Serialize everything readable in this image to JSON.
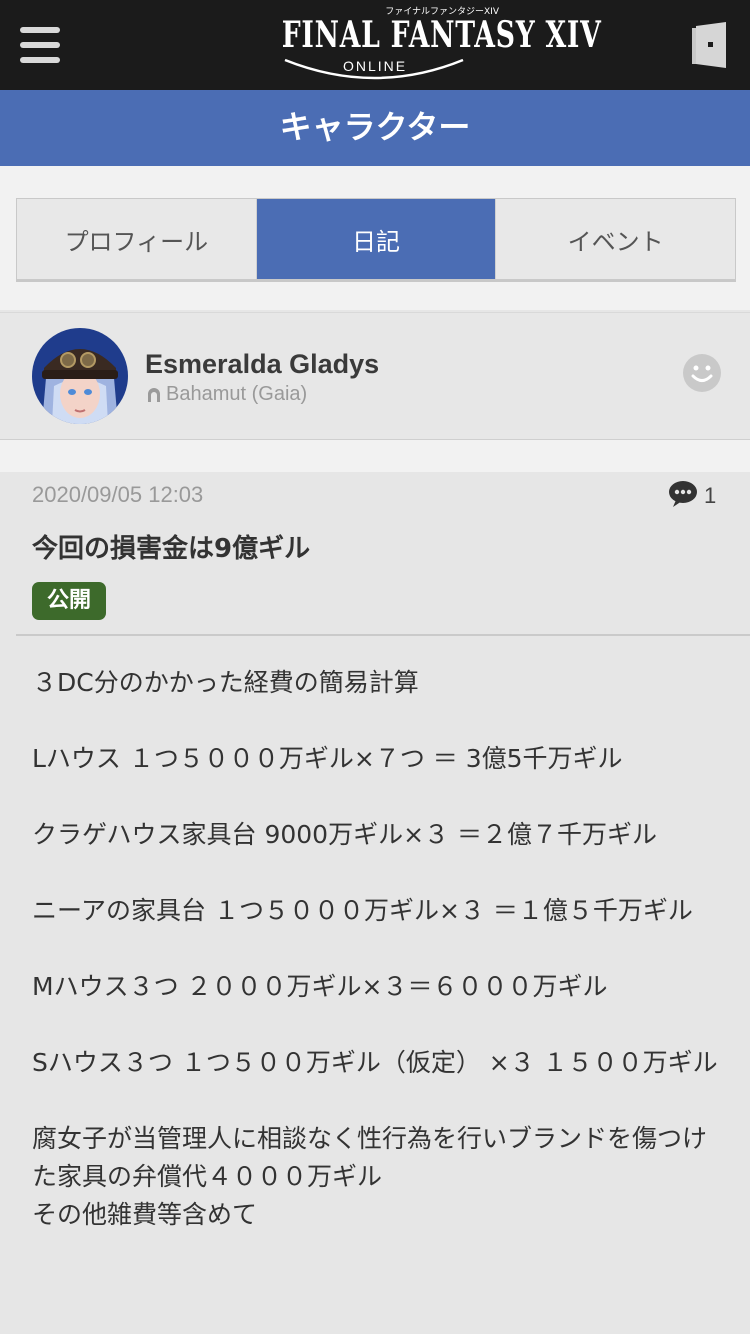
{
  "header": {
    "logo_top": "ファイナルファンタジーXIV",
    "logo_title": "FINAL FANTASY XIV",
    "logo_sub": "ONLINE",
    "menu_icon": "hamburger-menu-icon",
    "login_icon": "door-login-icon"
  },
  "section": {
    "title": "キャラクター"
  },
  "tabs": [
    {
      "label": "プロフィール",
      "active": false
    },
    {
      "label": "日記",
      "active": true
    },
    {
      "label": "イベント",
      "active": false
    }
  ],
  "character": {
    "name": "Esmeralda Gladys",
    "world": "Bahamut (Gaia)",
    "world_icon": "home-world-icon",
    "follow_icon": "smiley-icon"
  },
  "entry": {
    "date": "2020/09/05 12:03",
    "comment_icon": "speech-bubble-icon",
    "comment_count": "1",
    "title": "今回の損害金は9億ギル",
    "visibility": "公開",
    "paragraphs": [
      "３DC分のかかった経費の簡易計算",
      "Lハウス １つ５０００万ギル×７つ ＝ 3億5千万ギル",
      "クラゲハウス家具台 9000万ギル×３ ＝２億７千万ギル",
      "ニーアの家具台 １つ５０００万ギル×３ ＝１億５千万ギル",
      "Mハウス３つ ２０００万ギル×３＝６０００万ギル",
      "Sハウス３つ １つ５００万ギル（仮定） ×３ １５００万ギル",
      "腐女子が当管理人に相談なく性行為を行いブランドを傷つけた家具の弁償代４０００万ギル\nその他雑費等含めて"
    ]
  },
  "colors": {
    "topbar": "#1b1b1b",
    "accent": "#4b6db4",
    "badge": "#3d6a2b"
  }
}
